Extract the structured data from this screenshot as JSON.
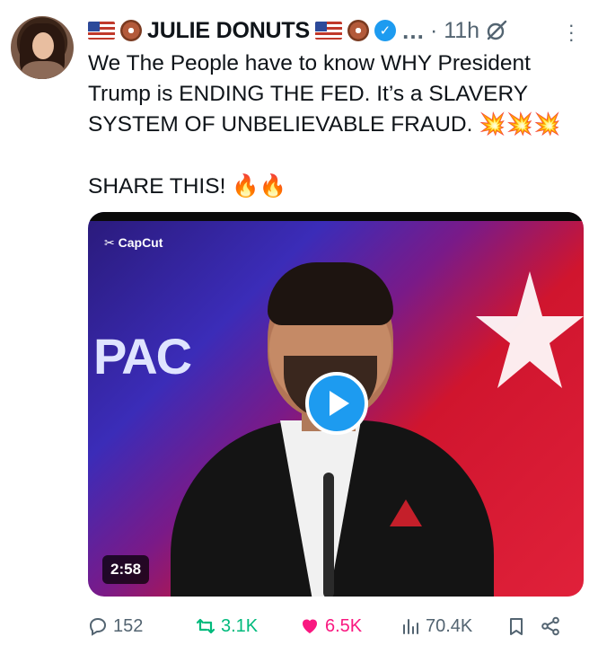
{
  "post": {
    "author_name": "JULIE DONUTS",
    "time": "· 11h",
    "more_label": "…",
    "text_lines": [
      "We The People have to know WHY President",
      "Trump is ENDING THE FED. It’s a SLAVERY",
      "SYSTEM OF UNBELIEVABLE FRAUD. 💥💥💥"
    ],
    "share_text": "SHARE THIS! 🔥🔥"
  },
  "video": {
    "watermark": "CapCut",
    "backdrop_text": "PAC",
    "duration": "2:58"
  },
  "actions": {
    "replies": "152",
    "reposts": "3.1K",
    "likes": "6.5K",
    "views": "70.4K"
  },
  "colors": {
    "verified": "#1d9bf0",
    "repost": "#00ba7c",
    "like": "#f91880",
    "muted": "#536471"
  }
}
